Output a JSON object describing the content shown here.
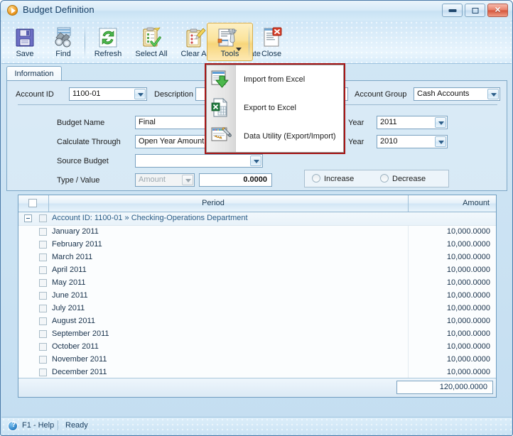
{
  "window": {
    "title": "Budget Definition",
    "icon": "play-circle-icon",
    "buttons": {
      "minimize": "Minimize",
      "maximize": "Maximize",
      "close": "Close"
    }
  },
  "toolbar": {
    "items": [
      {
        "label": "Save",
        "icon": "floppy-disk-icon",
        "active": false,
        "dropdown": false
      },
      {
        "label": "Find",
        "icon": "binoculars-icon",
        "active": false,
        "dropdown": false
      },
      {
        "label": "Refresh",
        "icon": "refresh-arrows-icon",
        "active": false,
        "dropdown": false
      },
      {
        "label": "Select All",
        "icon": "clipboard-check-icon",
        "active": false,
        "dropdown": false
      },
      {
        "label": "Clear All",
        "icon": "clipboard-erase-icon",
        "active": false,
        "dropdown": false
      },
      {
        "label": "Calculate",
        "icon": "calculator-icon",
        "active": false,
        "dropdown": false
      },
      {
        "label": "Tools",
        "icon": "tools-icon",
        "active": true,
        "dropdown": true
      },
      {
        "label": "Close",
        "icon": "close-document-icon",
        "active": false,
        "dropdown": false
      }
    ]
  },
  "tools_menu": {
    "items": [
      {
        "label": "Import from Excel",
        "icon": "import-excel-icon"
      },
      {
        "label": "Export to Excel",
        "icon": "export-excel-icon"
      },
      {
        "label": "Data Utility (Export/Import)",
        "icon": "data-utility-wand-icon"
      }
    ]
  },
  "tab": {
    "label": "Information"
  },
  "form": {
    "account_id_label": "Account ID",
    "account_id_value": "1100-01",
    "description_label": "Description",
    "description_value": "",
    "account_group_label": "Account Group",
    "account_group_value": "Cash Accounts",
    "budget_name_label": "Budget Name",
    "budget_name_value": "Final",
    "calculate_through_label": "Calculate Through",
    "calculate_through_value": "Open Year Amount",
    "source_budget_label": "Source Budget",
    "source_budget_value": "",
    "type_value_label": "Type / Value",
    "type_value": "Amount",
    "value_amount": "0.0000",
    "budget_year_label": "Year",
    "budget_year_value": "2011",
    "base_year_label": "Year",
    "base_year_value": "2010",
    "increase_label": "Increase",
    "decrease_label": "Decrease"
  },
  "grid": {
    "columns": [
      "",
      "Period",
      "Amount"
    ],
    "group_row": "Account ID: 1100-01 » Checking-Operations Department",
    "rows": [
      {
        "period": "January 2011",
        "amount": "10,000.0000"
      },
      {
        "period": "February 2011",
        "amount": "10,000.0000"
      },
      {
        "period": "March 2011",
        "amount": "10,000.0000"
      },
      {
        "period": "April 2011",
        "amount": "10,000.0000"
      },
      {
        "period": "May 2011",
        "amount": "10,000.0000"
      },
      {
        "period": "June 2011",
        "amount": "10,000.0000"
      },
      {
        "period": "July 2011",
        "amount": "10,000.0000"
      },
      {
        "period": "August 2011",
        "amount": "10,000.0000"
      },
      {
        "period": "September 2011",
        "amount": "10,000.0000"
      },
      {
        "period": "October 2011",
        "amount": "10,000.0000"
      },
      {
        "period": "November 2011",
        "amount": "10,000.0000"
      },
      {
        "period": "December 2011",
        "amount": "10,000.0000"
      }
    ],
    "total": "120,000.0000"
  },
  "status": {
    "help": "F1 - Help",
    "state": "Ready"
  },
  "colors": {
    "accent": "#2a7fc4",
    "highlight": "#f7d57a",
    "menu_outline": "#a51515",
    "title_text": "#153d63"
  }
}
